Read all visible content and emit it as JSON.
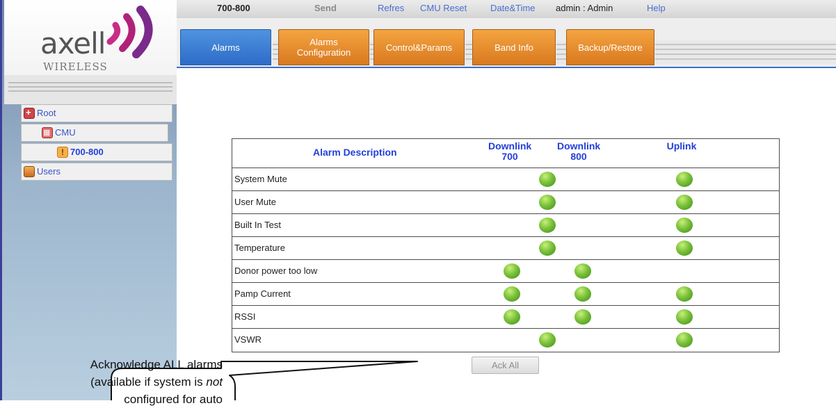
{
  "top_bar": {
    "device_name": "700-800",
    "send": "Send",
    "refresh": "Refres",
    "cmu_reset": "CMU Reset",
    "date_time": "Date&Time",
    "user_info": "admin : Admin",
    "help": "Help"
  },
  "logo": {
    "brand": "axell",
    "tagline": "WIRELESS"
  },
  "tree": {
    "root": "Root",
    "cmu": "CMU",
    "device": "700-800",
    "users": "Users"
  },
  "tabs": {
    "alarms": "Alarms",
    "alarms_configuration": "Alarms Configuration",
    "control_params": "Control&Params",
    "band_info": "Band Info",
    "backup_restore": "Backup/Restore"
  },
  "alarm_table": {
    "headers": {
      "description": "Alarm Description",
      "downlink_700": "Downlink 700",
      "downlink_800": "Downlink 800",
      "uplink": "Uplink"
    },
    "rows": [
      {
        "label": "System Mute",
        "downlink_combined": "green",
        "uplink": "green"
      },
      {
        "label": "User Mute",
        "downlink_combined": "green",
        "uplink": "green"
      },
      {
        "label": "Built In Test",
        "downlink_combined": "green",
        "uplink": "green"
      },
      {
        "label": "Temperature",
        "downlink_combined": "green",
        "uplink": "green"
      },
      {
        "label": "Donor power too low",
        "downlink_700": "green",
        "downlink_800": "green"
      },
      {
        "label": "Pamp Current",
        "downlink_700": "green",
        "downlink_800": "green",
        "uplink": "green"
      },
      {
        "label": "RSSI",
        "downlink_700": "green",
        "downlink_800": "green",
        "uplink": "green"
      },
      {
        "label": "VSWR",
        "downlink_combined": "green",
        "uplink": "green"
      }
    ]
  },
  "ack_all_label": "Ack All",
  "callout": {
    "line1": "Acknowledge ALL alarms",
    "line2_pre": "(available if system is ",
    "line2_em": "not",
    "line3": "configured for auto"
  },
  "colors": {
    "tab_orange": "#e8891f",
    "tab_blue": "#3a7fd6",
    "header_text": "#2340d8",
    "led_green": "#7ac13a"
  }
}
